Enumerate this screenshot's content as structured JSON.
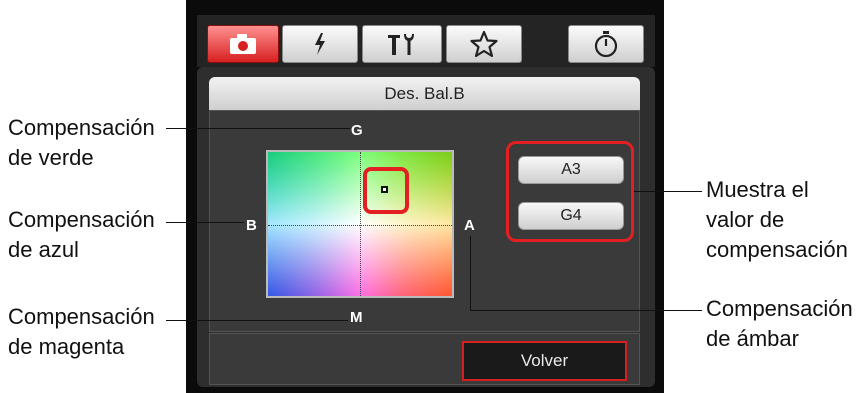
{
  "toolbar": {
    "tabs": [
      {
        "icon": "camera-icon",
        "active": true
      },
      {
        "icon": "flash-icon",
        "active": false
      },
      {
        "icon": "tools-icon",
        "active": false
      },
      {
        "icon": "star-icon",
        "active": false
      }
    ],
    "timer_icon": "timer-icon"
  },
  "panel": {
    "title": "Des. Bal.B",
    "axis": {
      "top": "G",
      "left": "B",
      "right": "A",
      "bottom": "M"
    },
    "values": {
      "amber": "A3",
      "green": "G4"
    },
    "back_label": "Volver"
  },
  "callouts": {
    "green": [
      "Compensación",
      "de verde"
    ],
    "blue": [
      "Compensación",
      "de azul"
    ],
    "magenta": [
      "Compensación",
      "de magenta"
    ],
    "display": [
      "Muestra el",
      "valor de",
      "compensación"
    ],
    "amber": [
      "Compensación",
      "de ámbar"
    ]
  },
  "colors": {
    "accent_red": "#e41f24",
    "panel_bg": "#3a3a3a"
  }
}
